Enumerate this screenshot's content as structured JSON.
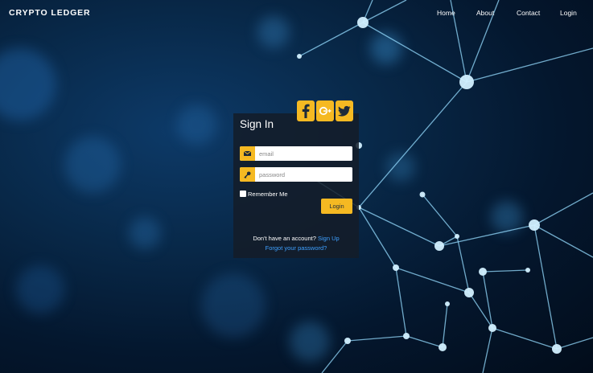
{
  "brand": "CRYPTO LEDGER",
  "nav": [
    "Home",
    "About",
    "Contact",
    "Login"
  ],
  "signin": {
    "title": "Sign In",
    "social": [
      "facebook-icon",
      "google-plus-icon",
      "twitter-icon"
    ],
    "email_placeholder": "email",
    "password_placeholder": "password",
    "remember_label": "Remember Me",
    "login_label": "Login",
    "signup_prompt": "Don't have an account?",
    "signup_link": "Sign Up",
    "forgot_link": "Forgot your password?"
  },
  "colors": {
    "accent": "#f5b922",
    "link": "#3ea0ff",
    "panel": "#141c28",
    "background": "#082848"
  }
}
